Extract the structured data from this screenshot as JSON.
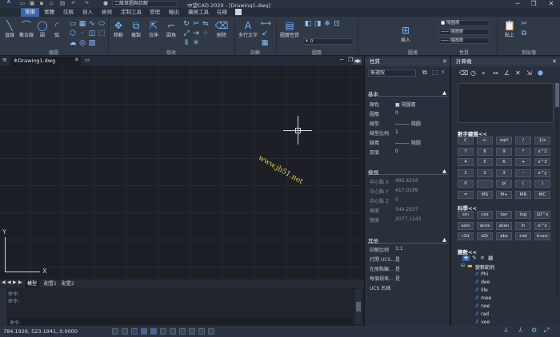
{
  "titlebar": {
    "workspace": "二維草圖與註解",
    "title": "中望CAD 2020 - [Drawing1.dwg]"
  },
  "ribbon_tabs": [
    "常用",
    "實體",
    "註解",
    "插入",
    "檢視",
    "定制工具",
    "管理",
    "輸出",
    "擴展工具",
    "在線"
  ],
  "ribbon": {
    "draw_label": "繪圖",
    "modify_label": "修改",
    "annot_label": "註解",
    "layer_label": "圖層",
    "block_label": "圖塊",
    "props_label": "性質",
    "clip_label": "剪貼簿",
    "btn_line": "直線",
    "btn_polyline": "聚合線",
    "btn_circle": "圓",
    "btn_arc": "弧",
    "btn_move": "移動",
    "btn_copy": "複製",
    "btn_stretch": "拉伸",
    "btn_fillet": "圓角",
    "btn_erase": "刪除",
    "btn_mtext": "多行文字",
    "btn_layerprops": "圖層性質",
    "btn_insert": "插入",
    "btn_paste": "貼上",
    "combo_color": "隨圖層",
    "combo_ltype": "隨圖層",
    "combo_lweight": "隨圖層",
    "combo_layer": "0"
  },
  "doc_tab": "Drawing1.dwg",
  "watermark": "www.jb51.net",
  "axis": {
    "x": "X",
    "y": "Y"
  },
  "layout_tabs": [
    "模型",
    "配置1",
    "配置2"
  ],
  "command": {
    "line1": "命令:",
    "line2": "命令:",
    "prompt": "命令:"
  },
  "status": {
    "coords": "784.1926, 523.1941, 0.0000"
  },
  "properties": {
    "title": "性質",
    "selection": "無選取",
    "sec_basic": "基本",
    "basic": [
      {
        "k": "顏色",
        "v": "■ 隨圖層"
      },
      {
        "k": "圖層",
        "v": "0"
      },
      {
        "k": "線型",
        "v": "——— 隨圖"
      },
      {
        "k": "線型比例",
        "v": "1"
      },
      {
        "k": "線寬",
        "v": "——— 隨圖"
      },
      {
        "k": "厚度",
        "v": "0"
      }
    ],
    "sec_view": "檢視",
    "view": [
      {
        "k": "中心點 X",
        "v": "485.4234"
      },
      {
        "k": "中心點 Y",
        "v": "417.0199"
      },
      {
        "k": "中心點 Z",
        "v": "0"
      },
      {
        "k": "高度",
        "v": "540.2537"
      },
      {
        "k": "寬度",
        "v": "2077.1243"
      }
    ],
    "sec_misc": "其他",
    "misc": [
      {
        "k": "註解比例",
        "v": "1:1"
      },
      {
        "k": "打開 UCS...",
        "v": "是"
      },
      {
        "k": "在原點顯...",
        "v": "是"
      },
      {
        "k": "每個視埠...",
        "v": "是"
      },
      {
        "k": "UCS 名稱",
        "v": ""
      }
    ]
  },
  "calculator": {
    "title": "計算機",
    "numpad_title": "數字鍵盤<<",
    "numpad": [
      "C",
      "<-",
      "sqrt",
      "/",
      "1/x",
      "7",
      "8",
      "9",
      "*",
      "x^2",
      "4",
      "5",
      "6",
      "+",
      "x^3",
      "1",
      "2",
      "3",
      "-",
      "x^y",
      "0",
      ".",
      "pi",
      "(",
      ")",
      "=",
      "MS",
      "M+",
      "MR",
      "MC"
    ],
    "sci_title": "科學<<",
    "sci": [
      "sin",
      "cos",
      "tan",
      "log",
      "10^x",
      "asin",
      "acos",
      "atan",
      "ln",
      "e^x",
      "r2d",
      "d2r",
      "abs",
      "rnd",
      "trunc"
    ],
    "var_title": "變數<<",
    "var_root": "變數範例",
    "vars": [
      "Phi",
      "dee",
      "ille",
      "mee",
      "nee",
      "rad",
      "vee"
    ]
  }
}
